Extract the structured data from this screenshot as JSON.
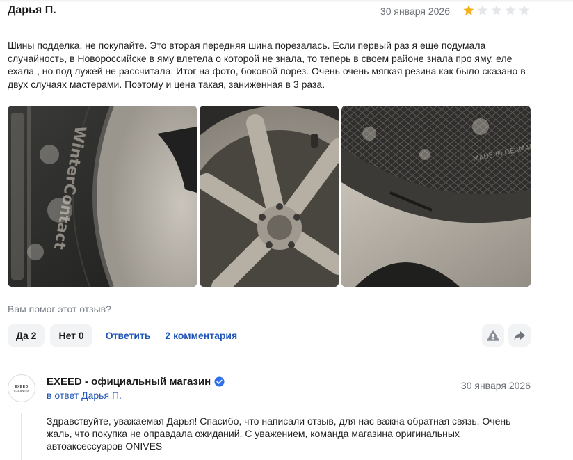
{
  "review": {
    "author": "Дарья П.",
    "date": "30 января 2026",
    "rating": 1,
    "max_rating": 5,
    "text": "Шины подделка, не покупайте. Это вторая передняя шина порезалась. Если первый раз я еще подумала случайность, в Новороссийске в яму влетела о которой не знала, то теперь в своем районе знала про яму, еле ехала , но под лужей не рассчитала. Итог на фото, боковой порез. Очень очень мягкая резина как было сказано в двух случаях мастерами. Поэтому и цена такая, заниженная в 3 раза.",
    "photos": [
      "tire-sidewall-photo",
      "wheel-rim-photo",
      "tire-cut-photo"
    ],
    "photo_text": [
      "WinterContact",
      "MADE IN GERMANY"
    ]
  },
  "helpful": {
    "question": "Вам помог этот отзыв?",
    "yes_label": "Да",
    "yes_count": "2",
    "no_label": "Нет",
    "no_count": "0",
    "reply_label": "Ответить",
    "comments_label": "2 комментария"
  },
  "icons": {
    "report": "warning-icon",
    "share": "share-arrow-icon",
    "verified": "verified-check-icon",
    "star": "star-icon"
  },
  "colors": {
    "star_active": "#f5b21b",
    "star_inactive": "#e4e6ea",
    "link": "#1f55b8",
    "verified": "#2f6fea"
  },
  "shop_reply": {
    "logo_line1": "EXEED",
    "logo_line2": "EXLANTIX",
    "name": "EXEED - официальный магазин",
    "in_reply_to": "в ответ Дарья П.",
    "date": "30 января 2026",
    "text": "Здравствуйте, уважаемая Дарья! Спасибо, что написали отзыв, для нас важна обратная связь. Очень жаль, что покупка не оправдала ожиданий. С уважением, команда магазина оригинальных автоаксессуаров ONIVES"
  }
}
